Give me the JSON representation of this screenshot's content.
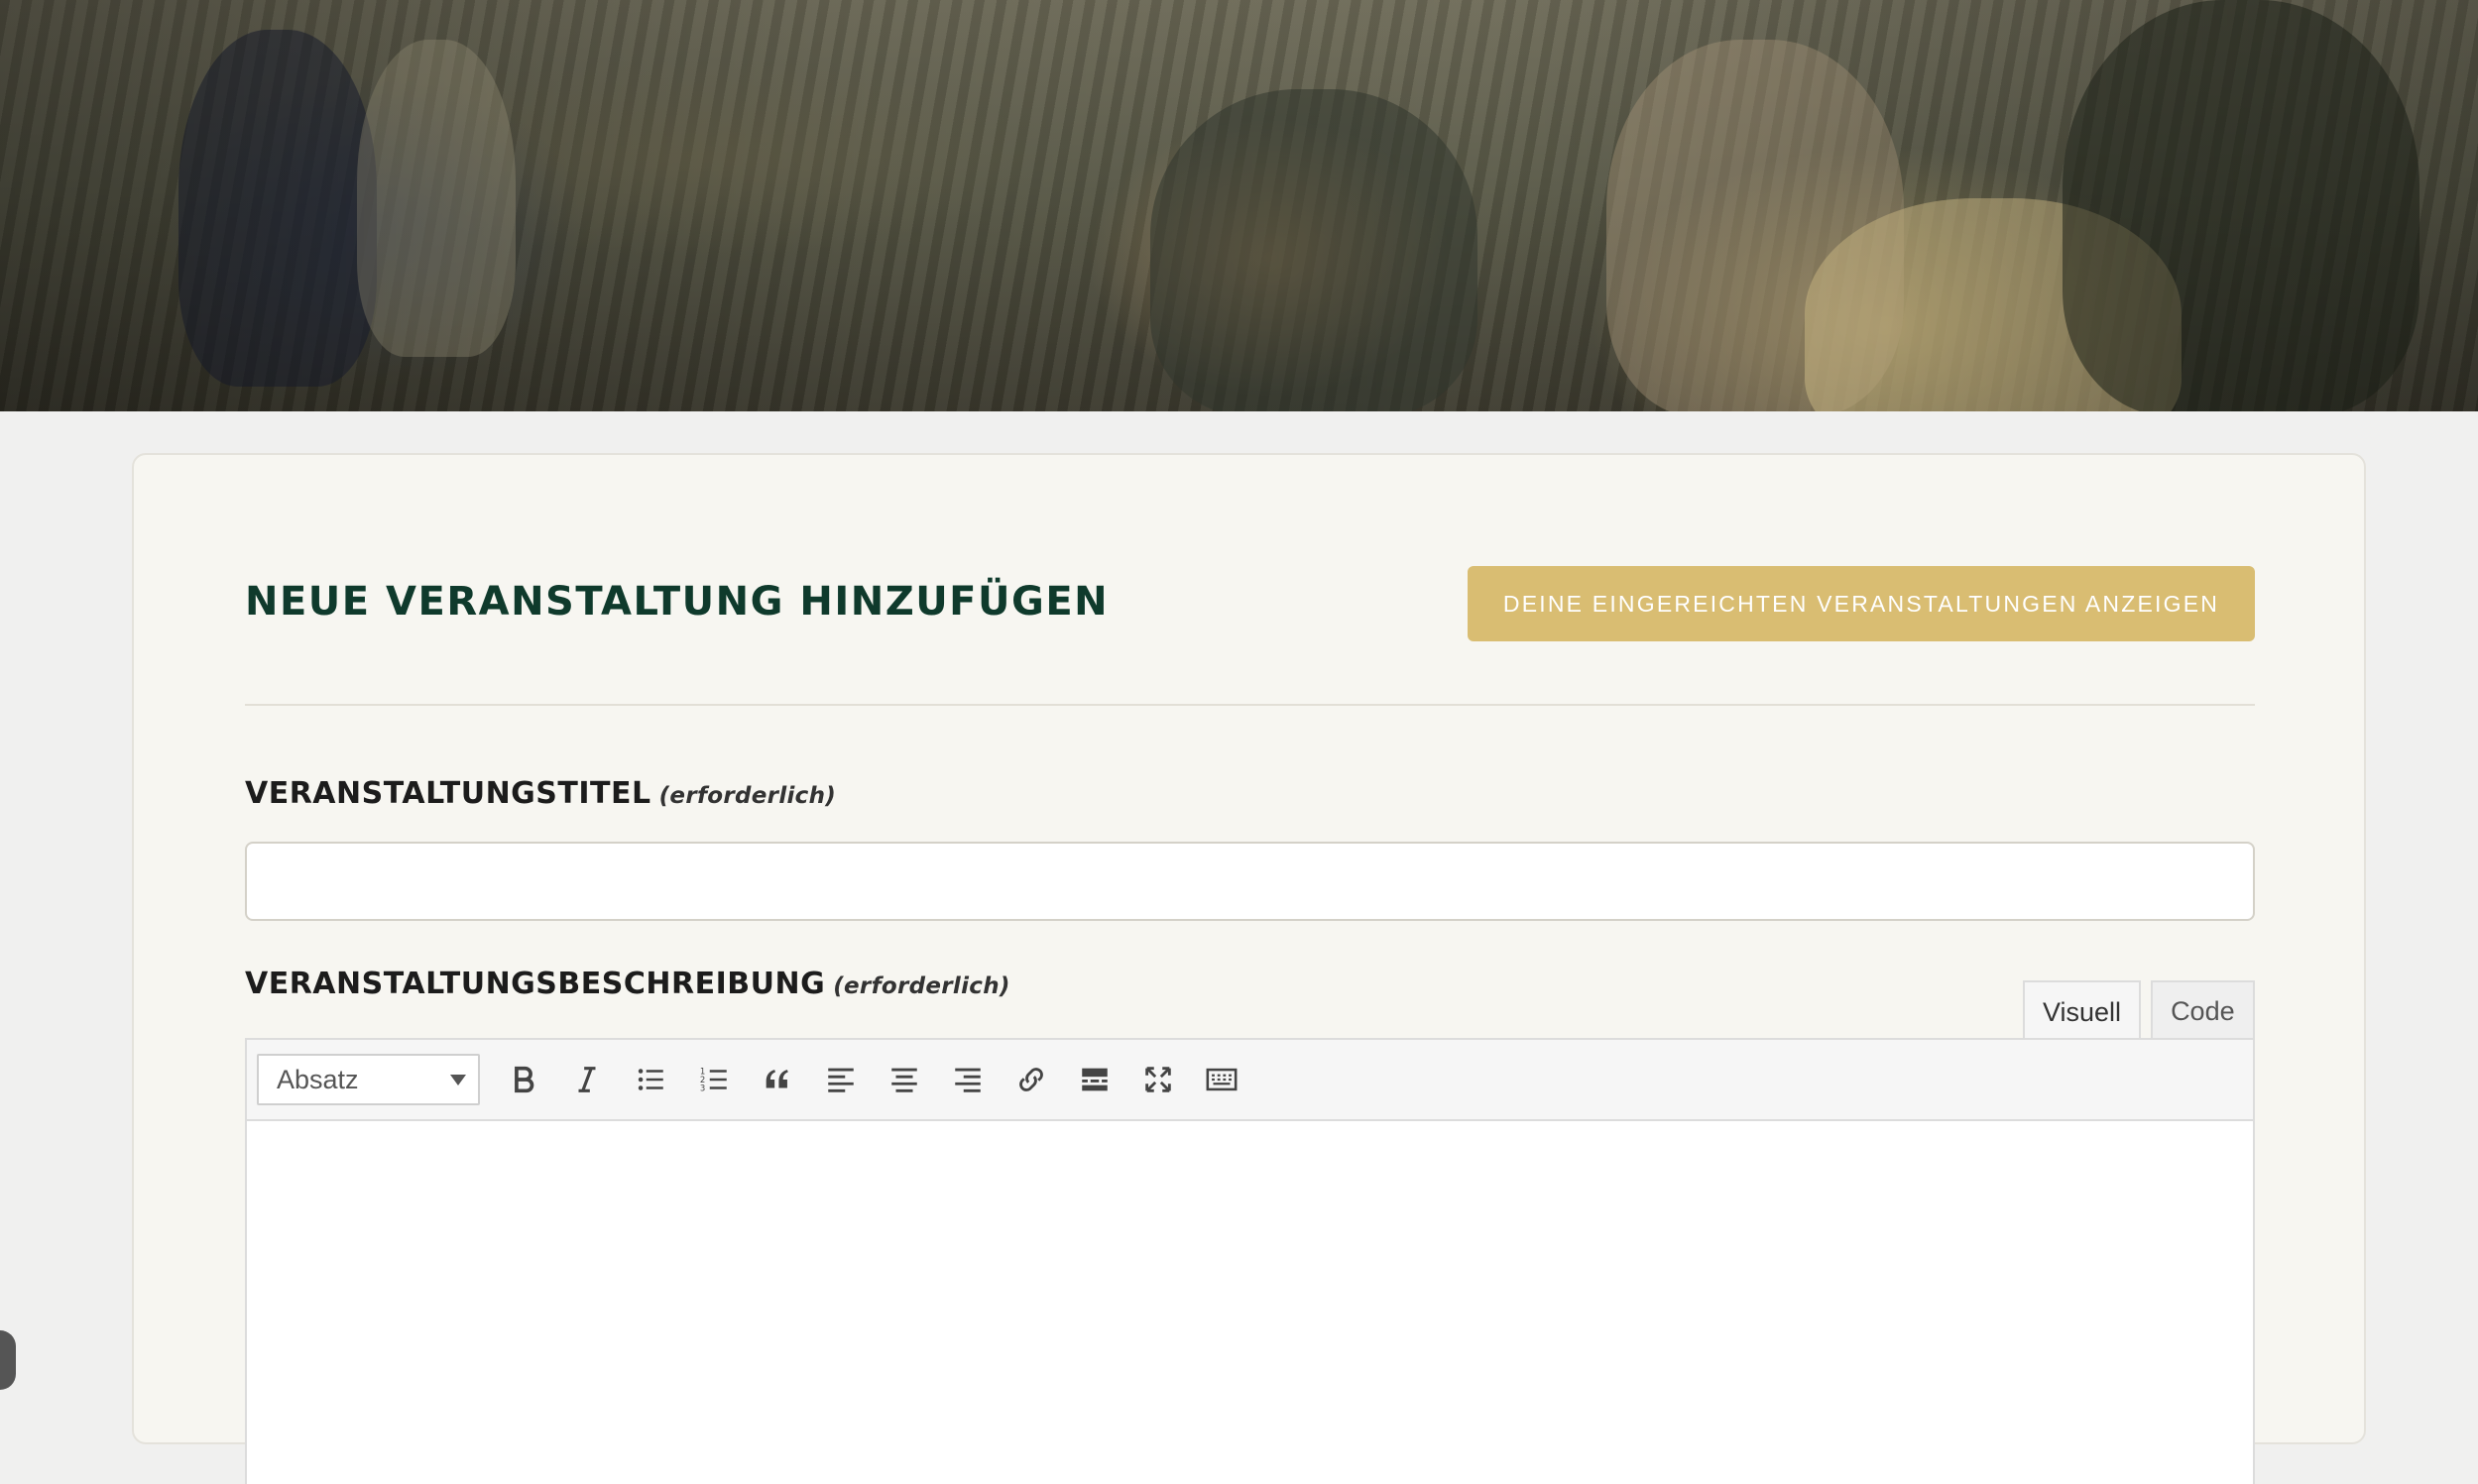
{
  "form": {
    "title": "NEUE VERANSTALTUNG HINZUFÜGEN",
    "submitted_button": "DEINE EINGEREICHTEN VERANSTALTUNGEN ANZEIGEN",
    "title_field": {
      "label": "VERANSTALTUNGSTITEL",
      "required": "(erforderlich)",
      "value": ""
    },
    "description_field": {
      "label": "VERANSTALTUNGSBESCHREIBUNG",
      "required": "(erforderlich)"
    }
  },
  "editor": {
    "tabs": [
      {
        "label": "Visuell",
        "active": true
      },
      {
        "label": "Code",
        "active": false
      }
    ],
    "format_select": "Absatz",
    "toolbar_icons": [
      "bold-icon",
      "italic-icon",
      "bullet-list-icon",
      "numbered-list-icon",
      "blockquote-icon",
      "align-left-icon",
      "align-center-icon",
      "align-right-icon",
      "link-icon",
      "read-more-icon",
      "fullscreen-icon",
      "toolbar-toggle-icon"
    ],
    "content": ""
  },
  "colors": {
    "accent": "#d9bd72",
    "heading": "#0f3a2c",
    "card_bg": "#f7f6f1"
  }
}
